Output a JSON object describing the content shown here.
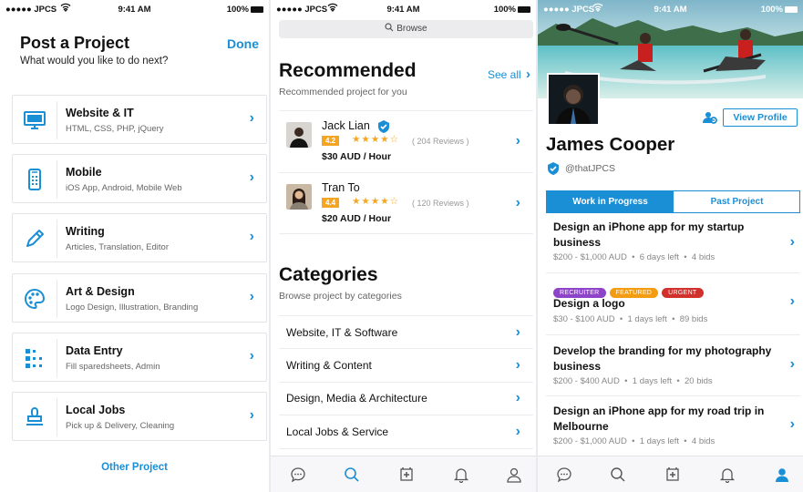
{
  "colors": {
    "accent": "#1a8fd6",
    "star": "#f4a623",
    "recruiter": "#8e44c9",
    "featured": "#f39c12",
    "urgent": "#d0312d"
  },
  "status": {
    "carrier": "●●●●● JPCS",
    "time": "9:41 AM",
    "battery": "100%"
  },
  "post": {
    "title": "Post a Project",
    "done": "Done",
    "subtitle": "What would you like to do next?",
    "categories": [
      {
        "title": "Website & IT",
        "sub": "HTML, CSS, PHP, jQuery",
        "icon": "monitor-icon"
      },
      {
        "title": "Mobile",
        "sub": "iOS App, Android, Mobile Web",
        "icon": "phone-icon"
      },
      {
        "title": "Writing",
        "sub": "Articles, Translation, Editor",
        "icon": "pencil-icon"
      },
      {
        "title": "Art & Design",
        "sub": "Logo Design, Illustration, Branding",
        "icon": "palette-icon"
      },
      {
        "title": "Data Entry",
        "sub": "Fill sparedsheets, Admin",
        "icon": "grid-icon"
      },
      {
        "title": "Local Jobs",
        "sub": "Pick up & Delivery, Cleaning",
        "icon": "stamp-icon"
      }
    ],
    "other": "Other Project"
  },
  "browse": {
    "search_placeholder": "Browse",
    "recommended_title": "Recommended",
    "recommended_sub": "Recommended project for you",
    "see_all": "See all",
    "freelancers": [
      {
        "name": "Jack Lian",
        "rating": "4.2",
        "stars": "★★★★☆",
        "reviews": "( 204 Reviews )",
        "rate": "$30 AUD / Hour",
        "verified": true
      },
      {
        "name": "Tran To",
        "rating": "4.4",
        "stars": "★★★★☆",
        "reviews": "( 120 Reviews )",
        "rate": "$20 AUD / Hour",
        "verified": false
      }
    ],
    "categories_title": "Categories",
    "categories_sub": "Browse project by categories",
    "categories": [
      "Website, IT & Software",
      "Writing & Content",
      "Design, Media & Architecture",
      "Local Jobs & Service"
    ]
  },
  "profile": {
    "view_profile": "View Profile",
    "name": "James Cooper",
    "handle": "@thatJPCS",
    "tabs": [
      "Work in Progress",
      "Past Project"
    ],
    "projects": [
      {
        "title": "Design an iPhone app for my startup business",
        "budget": "$200 - $1,000 AUD",
        "days": "6 days left",
        "bids": "4 bids",
        "tags": []
      },
      {
        "title": "Design a logo",
        "budget": "$30 - $100 AUD",
        "days": "1 days left",
        "bids": "89 bids",
        "tags": [
          "RECRUITER",
          "FEATURED",
          "URGENT"
        ]
      },
      {
        "title": "Develop the branding for my photography business",
        "budget": "$200 - $400 AUD",
        "days": "1 days left",
        "bids": "20 bids",
        "tags": []
      },
      {
        "title": "Design an iPhone app for my road trip in Melbourne",
        "budget": "$200 - $1,000 AUD",
        "days": "1 days left",
        "bids": "4 bids",
        "tags": []
      }
    ]
  },
  "tabbar": {
    "icons": [
      "chat-icon",
      "search-icon",
      "add-project-icon",
      "bell-icon",
      "profile-icon"
    ]
  }
}
